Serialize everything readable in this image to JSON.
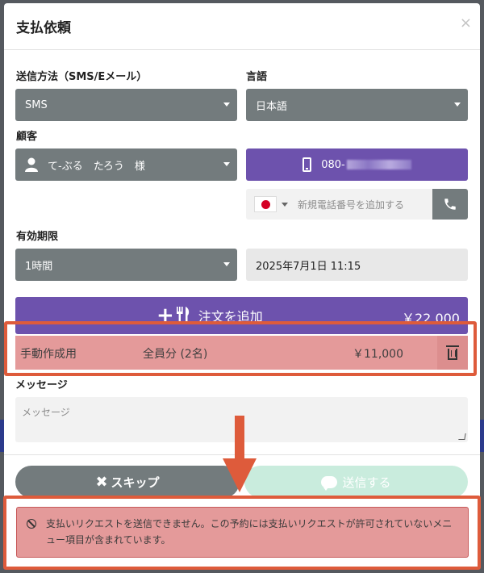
{
  "modal": {
    "title": "支払依頼",
    "close_icon": "close-icon"
  },
  "send_method": {
    "label": "送信方法（SMS/Eメール）",
    "value": "SMS"
  },
  "language": {
    "label": "言語",
    "value": "日本語"
  },
  "customer": {
    "label": "顧客",
    "value": "て-ぶる　たろう　様",
    "icon": "user-icon"
  },
  "phone": {
    "number_prefix": "080-",
    "icon": "mobile-phone-icon"
  },
  "add_phone": {
    "placeholder": "新規電話番号を追加する",
    "flag": "japan-flag-icon",
    "call_icon": "phone-icon"
  },
  "expiry": {
    "label": "有効期限",
    "value": "1時間",
    "date": "2025年7月1日 11:15"
  },
  "order": {
    "add_label": "注文を追加",
    "total": "￥22,000",
    "icons": [
      "plus-icon",
      "utensils-icon"
    ]
  },
  "order_items": [
    {
      "name": "手動作成用",
      "target": "全員分 (2名)",
      "price": "￥11,000"
    }
  ],
  "message": {
    "label": "メッセージ",
    "placeholder": "メッセージ"
  },
  "buttons": {
    "skip": "スキップ",
    "send": "送信する"
  },
  "alert": {
    "text": "支払いリクエストを送信できません。この予約には支払いリクエストが許可されていないメニュー項目が含まれています。"
  },
  "colors": {
    "primary": "#6d52ad",
    "gray": "#737b7d",
    "highlight": "#de5b3b",
    "error_bg": "#e49a9a",
    "send_disabled": "#c9ecdd"
  }
}
